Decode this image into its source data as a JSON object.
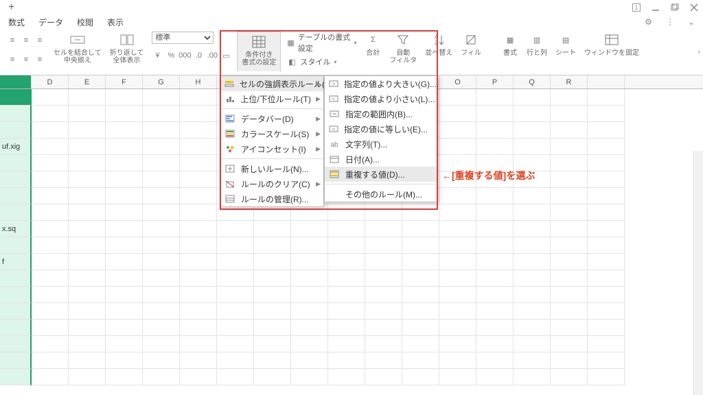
{
  "window": {
    "plus": "+"
  },
  "menus": {
    "items": [
      "数式",
      "データ",
      "校閲",
      "表示"
    ]
  },
  "ribbon": {
    "indent_group": "",
    "merge": "セルを結合して\n中央揃え",
    "wrap": "折り返して\n全体表示",
    "numfmt": "標準",
    "cond": "条件付き\n書式の設定",
    "tablefmt": "テーブルの書式設定",
    "style": "スタイル",
    "sum": "合計",
    "filter": "自動\nフィルタ",
    "sort": "並べ替え",
    "fill": "フィル",
    "format": "書式",
    "rowcol": "行と列",
    "sheet": "シート",
    "freeze": "ウィンドウを固定"
  },
  "columns": [
    "",
    "D",
    "E",
    "F",
    "G",
    "H",
    "",
    "",
    "",
    "",
    "",
    "",
    "O",
    "P",
    "Q",
    "R",
    ""
  ],
  "cells": {
    "c3": "uf.xig",
    "c5": "x.sq",
    "c6": "f",
    "c7": ""
  },
  "menu1": {
    "items": [
      {
        "k": "highlight",
        "label": "セルの強調表示ルール(H)",
        "sub": true,
        "hover": true
      },
      {
        "k": "toprank",
        "label": "上位/下位ルール(T)",
        "sub": true
      },
      {
        "sep": true
      },
      {
        "k": "databar",
        "label": "データバー(D)",
        "sub": true
      },
      {
        "k": "colorscale",
        "label": "カラースケール(S)",
        "sub": true
      },
      {
        "k": "iconset",
        "label": "アイコンセット(I)",
        "sub": true
      },
      {
        "sep": true
      },
      {
        "k": "newrule",
        "label": "新しいルール(N)..."
      },
      {
        "k": "clear",
        "label": "ルールのクリア(C)",
        "sub": true
      },
      {
        "k": "manage",
        "label": "ルールの管理(R)..."
      }
    ]
  },
  "menu2": {
    "items": [
      {
        "k": "gt",
        "label": "指定の値より大きい(G)..."
      },
      {
        "k": "lt",
        "label": "指定の値より小さい(L)..."
      },
      {
        "k": "between",
        "label": "指定の範囲内(B)..."
      },
      {
        "k": "eq",
        "label": "指定の値に等しい(E)..."
      },
      {
        "k": "text",
        "label": "文字列(T)..."
      },
      {
        "k": "date",
        "label": "日付(A)..."
      },
      {
        "k": "dup",
        "label": "重複する値(D)...",
        "hover": true
      },
      {
        "sep": true
      },
      {
        "k": "other",
        "label": "その他のルール(M)...",
        "noicon": true
      }
    ]
  },
  "annotation": "←[重複する値]を選ぶ"
}
